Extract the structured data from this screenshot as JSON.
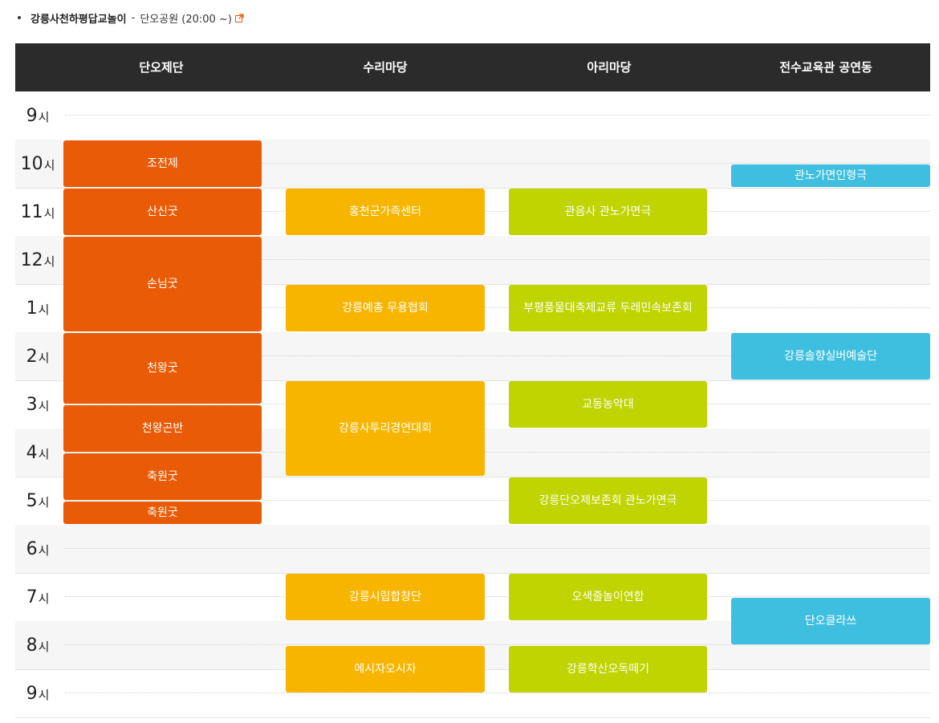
{
  "notice": {
    "title": "강릉사천하평답교놀이",
    "separator": "-",
    "place": "단오공원 (20:00 ~)",
    "link_icon": "external-link-icon"
  },
  "venues": [
    "단오제단",
    "수리마당",
    "아리마당",
    "전수교육관 공연동"
  ],
  "hour_unit": "시",
  "hours": [
    "9",
    "10",
    "11",
    "12",
    "1",
    "2",
    "3",
    "4",
    "5",
    "6",
    "7",
    "8",
    "9"
  ],
  "events": [
    {
      "venue": 0,
      "label": "조전제",
      "start": 1,
      "end": 2
    },
    {
      "venue": 0,
      "label": "산신굿",
      "start": 2,
      "end": 3
    },
    {
      "venue": 0,
      "label": "손님굿",
      "start": 3,
      "end": 5
    },
    {
      "venue": 0,
      "label": "천왕굿",
      "start": 5,
      "end": 6.5
    },
    {
      "venue": 0,
      "label": "천왕곤반",
      "start": 6.5,
      "end": 7.5
    },
    {
      "venue": 0,
      "label": "축원굿",
      "start": 7.5,
      "end": 8.5
    },
    {
      "venue": 0,
      "label": "축원굿",
      "start": 8.5,
      "end": 9
    },
    {
      "venue": 1,
      "label": "홍천군가족센터",
      "start": 2,
      "end": 3
    },
    {
      "venue": 1,
      "label": "강릉예총 무용협회",
      "start": 4,
      "end": 5
    },
    {
      "venue": 1,
      "label": "강릉사투리경연대회",
      "start": 6,
      "end": 8
    },
    {
      "venue": 1,
      "label": "강릉시립합창단",
      "start": 10,
      "end": 11
    },
    {
      "venue": 1,
      "label": "에시자오시자",
      "start": 11.5,
      "end": 12.5
    },
    {
      "venue": 2,
      "label": "관음사 관노가면극",
      "start": 2,
      "end": 3
    },
    {
      "venue": 2,
      "label": "부평풍물대축제교류 두레민속보존회",
      "start": 4,
      "end": 5
    },
    {
      "venue": 2,
      "label": "교동농악대",
      "start": 6,
      "end": 7
    },
    {
      "venue": 2,
      "label": "강릉단오제보존회 관노가면극",
      "start": 8,
      "end": 9
    },
    {
      "venue": 2,
      "label": "오색줄놀이연합",
      "start": 10,
      "end": 11
    },
    {
      "venue": 2,
      "label": "강릉학산오독떼기",
      "start": 11.5,
      "end": 12.5
    },
    {
      "venue": 3,
      "label": "관노가면인형극",
      "start": 1.5,
      "end": 2
    },
    {
      "venue": 3,
      "label": "강릉솔향실버예술단",
      "start": 5,
      "end": 6
    },
    {
      "venue": 3,
      "label": "단오클라쓰",
      "start": 10.5,
      "end": 11.5
    }
  ],
  "colors": {
    "header_bg": "#2b2b2b",
    "venue_colors": [
      "#e95b06",
      "#f8b500",
      "#bfd400",
      "#3fbfe0"
    ]
  }
}
